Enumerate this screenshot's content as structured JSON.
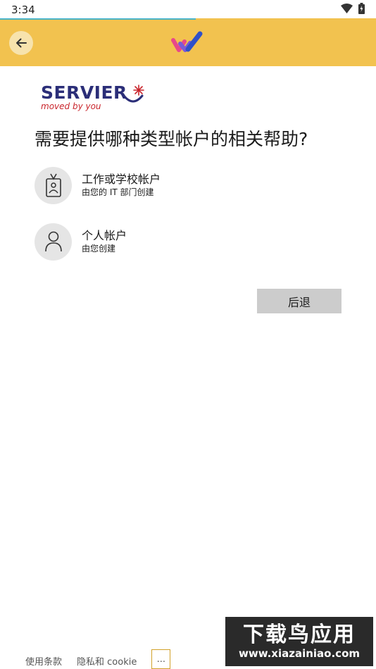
{
  "status_bar": {
    "time": "3:34",
    "progress": 0.52
  },
  "header": {
    "back_icon": "arrow-left-icon"
  },
  "brand": {
    "name": "SERVIER",
    "tagline": "moved by you"
  },
  "title": "需要提供哪种类型帐户的相关帮助?",
  "options": [
    {
      "label": "工作或学校帐户",
      "sublabel": "由您的 IT 部门创建",
      "icon": "badge-icon"
    },
    {
      "label": "个人帐户",
      "sublabel": "由您创建",
      "icon": "person-icon"
    }
  ],
  "back_button_label": "后退",
  "footer": {
    "terms": "使用条款",
    "privacy": "隐私和 cookie",
    "more": "..."
  },
  "watermark": {
    "title": "下载鸟应用",
    "url": "www.xiazainiao.com"
  },
  "colors": {
    "header": "#f2c24f",
    "brand": "#2b2e78",
    "accent": "#c9252c",
    "progress": "#49b4c9"
  }
}
